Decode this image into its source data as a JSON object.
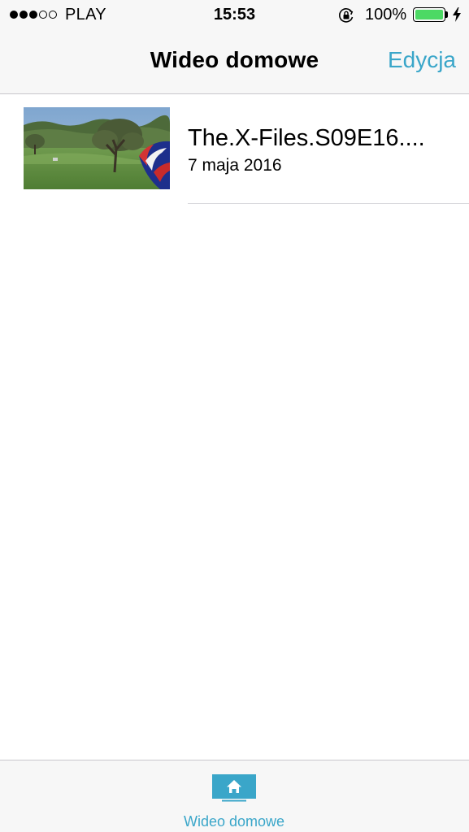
{
  "status_bar": {
    "signal_filled": 3,
    "signal_total": 5,
    "carrier": "PLAY",
    "time": "15:53",
    "orientation_lock_icon": "rotation-lock-icon",
    "battery_percent_text": "100%",
    "battery_level": 1.0,
    "charging_icon": "bolt-icon"
  },
  "nav": {
    "title": "Wideo domowe",
    "edit_label": "Edycja"
  },
  "videos": [
    {
      "title": "The.X-Files.S09E16....",
      "date": "7 maja 2016",
      "thumbnail": "landscape-tree-flag-thumbnail"
    }
  ],
  "tab_bar": {
    "items": [
      {
        "label": "Wideo domowe",
        "icon": "home-icon",
        "selected": true
      }
    ]
  },
  "colors": {
    "accent": "#3aa6c9",
    "bar_background": "#f7f7f7",
    "separator": "#c8c7cc",
    "battery_fill": "#4cd964"
  }
}
